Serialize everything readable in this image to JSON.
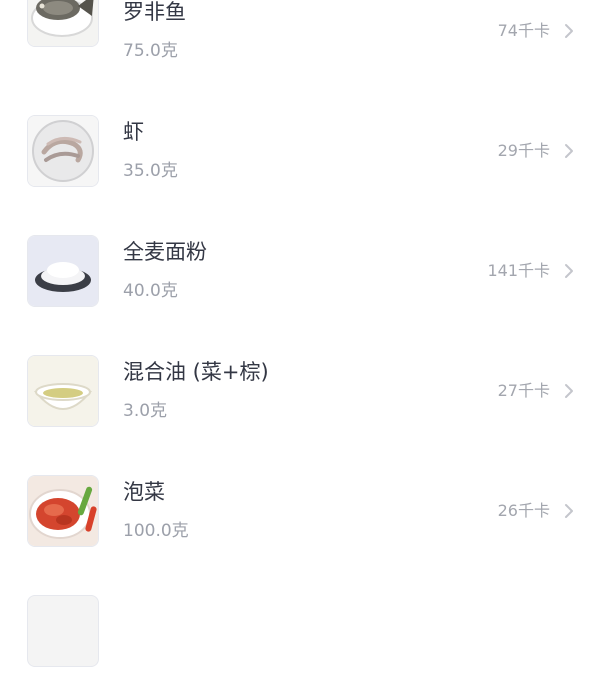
{
  "foods": [
    {
      "name": "罗非鱼",
      "weight": "75.0克",
      "kcal": "74千卡",
      "icon": "tilapia-fish-photo"
    },
    {
      "name": "虾",
      "weight": "35.0克",
      "kcal": "29千卡",
      "icon": "shrimp-photo"
    },
    {
      "name": "全麦面粉",
      "weight": "40.0克",
      "kcal": "141千卡",
      "icon": "flour-bowl-photo"
    },
    {
      "name": "混合油 (菜+棕)",
      "weight": "3.0克",
      "kcal": "27千卡",
      "icon": "oil-bowl-photo"
    },
    {
      "name": "泡菜",
      "weight": "100.0克",
      "kcal": "26千卡",
      "icon": "kimchi-plate-photo"
    }
  ],
  "colors": {
    "name_text": "#333744",
    "secondary_text": "#9ca0aa",
    "chevron": "#c4c6cc",
    "thumb_border": "#e6e8ee"
  }
}
